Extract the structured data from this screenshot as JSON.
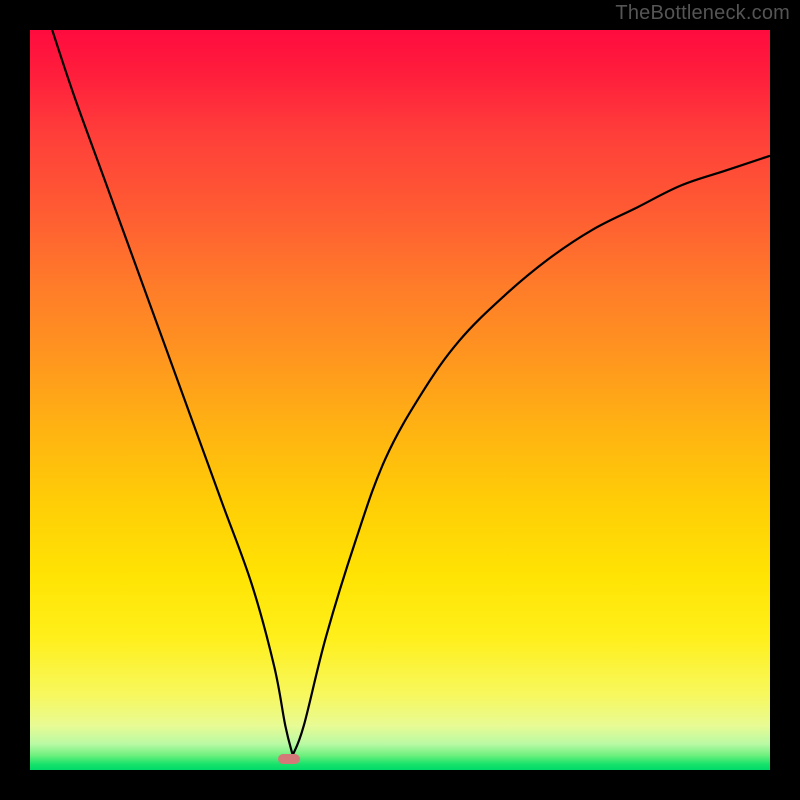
{
  "watermark": "TheBottleneck.com",
  "chart_data": {
    "type": "line",
    "title": "",
    "xlabel": "",
    "ylabel": "",
    "xlim": [
      0,
      100
    ],
    "ylim": [
      0,
      100
    ],
    "series": [
      {
        "name": "bottleneck-curve",
        "x": [
          3,
          6,
          10,
          14,
          18,
          22,
          26,
          30,
          33,
          34.5,
          35.5,
          37,
          40,
          44,
          48,
          53,
          58,
          64,
          70,
          76,
          82,
          88,
          94,
          100
        ],
        "values": [
          100,
          91,
          80,
          69,
          58,
          47,
          36,
          25,
          14,
          6,
          2,
          6,
          18,
          31,
          42,
          51,
          58,
          64,
          69,
          73,
          76,
          79,
          81,
          83
        ]
      }
    ],
    "marker": {
      "x": 35,
      "y": 1.5,
      "color": "#d37a78"
    },
    "gradient_stops": [
      {
        "pos": 0,
        "color": "#ff0b3e"
      },
      {
        "pos": 50,
        "color": "#ffb300"
      },
      {
        "pos": 80,
        "color": "#fff000"
      },
      {
        "pos": 100,
        "color": "#00d96a"
      }
    ]
  }
}
